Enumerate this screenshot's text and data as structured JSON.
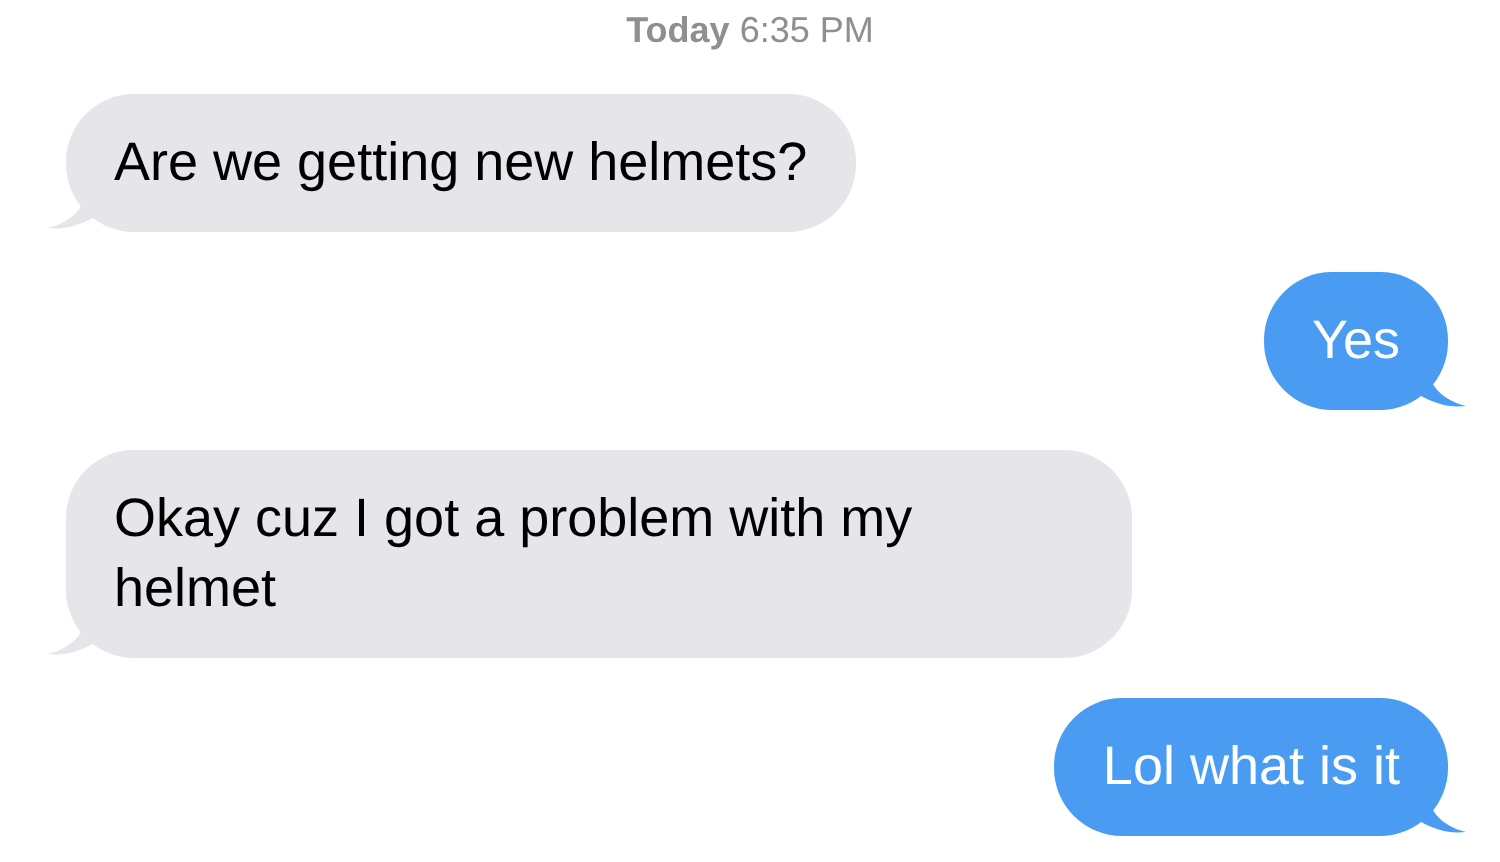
{
  "timestamp": {
    "day": "Today",
    "time": "6:35 PM"
  },
  "messages": [
    {
      "kind": "incoming",
      "text": "Are we getting new helmets?"
    },
    {
      "kind": "outgoing",
      "text": "Yes"
    },
    {
      "kind": "incoming",
      "text": "Okay cuz I got a problem with my helmet"
    },
    {
      "kind": "outgoing",
      "text": "Lol what is it"
    }
  ]
}
